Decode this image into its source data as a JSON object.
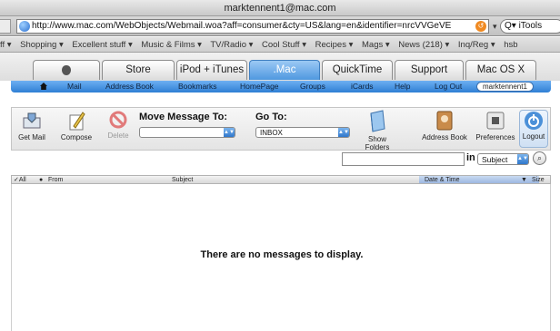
{
  "window": {
    "title": "marktennent1@mac.com"
  },
  "browser": {
    "url": "http://www.mac.com/WebObjects/Webmail.woa?aff=consumer&cty=US&lang=en&identifier=nrcVVGeVE",
    "search_value": "iTools"
  },
  "bookmarks": [
    "ff ▾",
    "Shopping ▾",
    "Excellent stuff ▾",
    "Music & Films ▾",
    "TV/Radio ▾",
    "Cool Stuff ▾",
    "Recipes ▾",
    "Mags ▾",
    "News (218) ▾",
    "Inq/Reg ▾",
    "hsb"
  ],
  "site_tabs": [
    "Store",
    "iPod + iTunes",
    ".Mac",
    "QuickTime",
    "Support",
    "Mac OS X"
  ],
  "nav": {
    "items": [
      "Mail",
      "Address Book",
      "Bookmarks",
      "HomePage",
      "Groups",
      "iCards",
      "Help",
      "Log Out"
    ],
    "user": "marktennent1"
  },
  "toolbar": {
    "get_mail": "Get Mail",
    "compose": "Compose",
    "delete": "Delete",
    "move_label": "Move Message To:",
    "move_value": "",
    "goto_label": "Go To:",
    "goto_value": "INBOX",
    "show_folders": "Show Folders",
    "address_book": "Address Book",
    "preferences": "Preferences",
    "logout": "Logout"
  },
  "search": {
    "in_label": "in",
    "field_value": "Subject"
  },
  "list": {
    "columns": {
      "all": "✓All",
      "from": "From",
      "subject": "Subject",
      "date": "Date & Time",
      "size": "Size"
    },
    "empty_text": "There are no messages to display."
  },
  "colors": {
    "accent": "#3f8ee0",
    "tab_active": "#5aa0e6"
  }
}
